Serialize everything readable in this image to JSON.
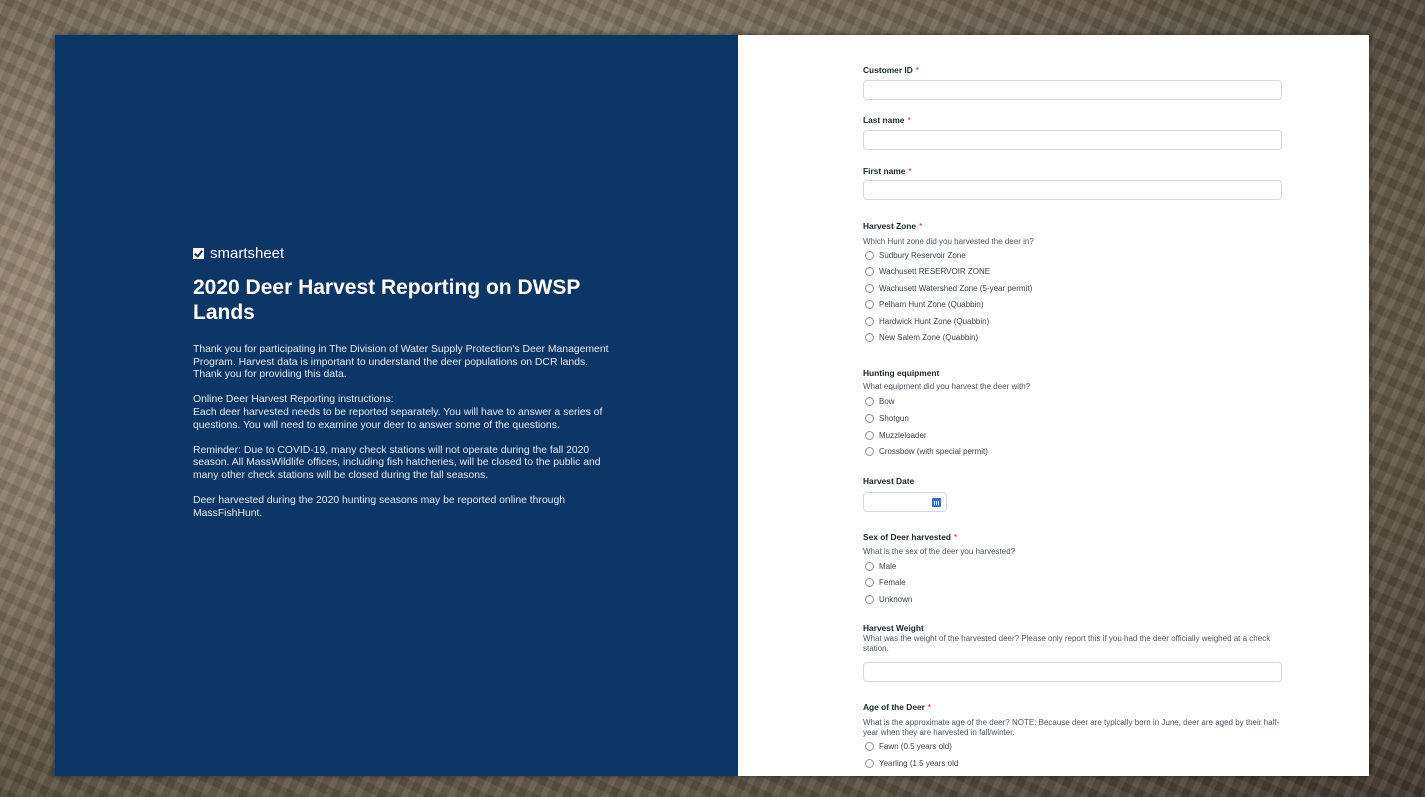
{
  "left_panel": {
    "brand": "smartsheet",
    "title": "2020 Deer Harvest Reporting on DWSP Lands",
    "paragraphs": [
      "Thank you for participating in The Division of Water Supply Protection's Deer Management Program.  Harvest data is important to understand the deer populations on DCR lands.  Thank you for providing this data.",
      "Online Deer Harvest Reporting instructions:\nEach deer harvested needs to be reported separately.  You will have to answer a series of questions. You will need to examine your deer to answer some of the questions.",
      "Reminder:  Due to COVID-19, many check stations will not operate during the fall 2020 season.  All MassWildlife offices, including fish hatcheries, will be closed to the public and many other check stations will be closed during the fall seasons.",
      "Deer harvested during the 2020 hunting seasons may be reported online through MassFishHunt."
    ]
  },
  "form": {
    "required_mark": "*",
    "customer_id": {
      "label": "Customer ID",
      "value": ""
    },
    "last_name": {
      "label": "Last name",
      "value": ""
    },
    "first_name": {
      "label": "First name",
      "value": ""
    },
    "harvest_zone": {
      "label": "Harvest Zone",
      "help": "Which Hunt zone did you harvested the deer in?",
      "options": [
        "Sudbury Reservoir Zone",
        "Wachusett RESERVOIR ZONE",
        "Wachusett Watershed Zone (5-year permit)",
        "Pelham Hunt Zone (Quabbin)",
        "Hardwick Hunt Zone (Quabbin)",
        "New Salem Zone (Quabbin)"
      ]
    },
    "hunting_equipment": {
      "label": "Hunting equipment",
      "help": "What equipment did you harvest the deer with?",
      "options": [
        "Bow",
        "Shotgun",
        "Muzzleloader",
        "Crossbow (with special permit)"
      ]
    },
    "harvest_date": {
      "label": "Harvest Date",
      "value": "",
      "icon": "calendar-icon"
    },
    "sex": {
      "label": "Sex of Deer harvested",
      "help": "What is the sex of the deer you harvested?",
      "options": [
        "Male",
        "Female",
        "Unknown"
      ]
    },
    "harvest_weight": {
      "label": "Harvest Weight",
      "help": "What was the weight of the harvested deer?  Please only report this if you had the deer officially weighed at a check station.",
      "value": ""
    },
    "age": {
      "label": "Age of the Deer",
      "help": "What is the approximate age of the deer?  NOTE: Because deer are typically born in June, deer are aged by their half-year when they are harvested in fall/winter.",
      "options": [
        "Fawn (0.5 years old)",
        "Yearling (1.5 years old"
      ]
    }
  },
  "colors": {
    "panel": "#0b3666",
    "required": "#dd2222",
    "calendar": "#2d6fd1"
  }
}
